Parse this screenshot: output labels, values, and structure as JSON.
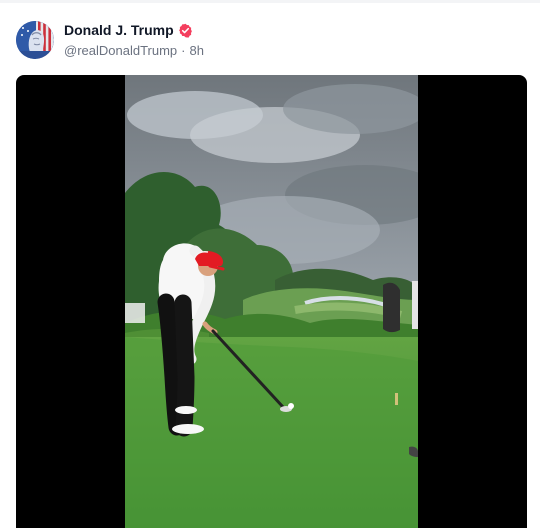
{
  "post": {
    "author_name": "Donald J. Trump",
    "handle": "@realDonaldTrump",
    "separator": "·",
    "time": "8h",
    "verified": true,
    "verified_color": "#f43f5e"
  },
  "media": {
    "type": "video",
    "description_icon": "golf-video-icon"
  },
  "icons": {
    "avatar": "avatar-icon",
    "verified": "verified-badge-icon"
  },
  "colors": {
    "name_text": "#111827",
    "secondary_text": "#6b7280",
    "media_background": "#000000"
  }
}
